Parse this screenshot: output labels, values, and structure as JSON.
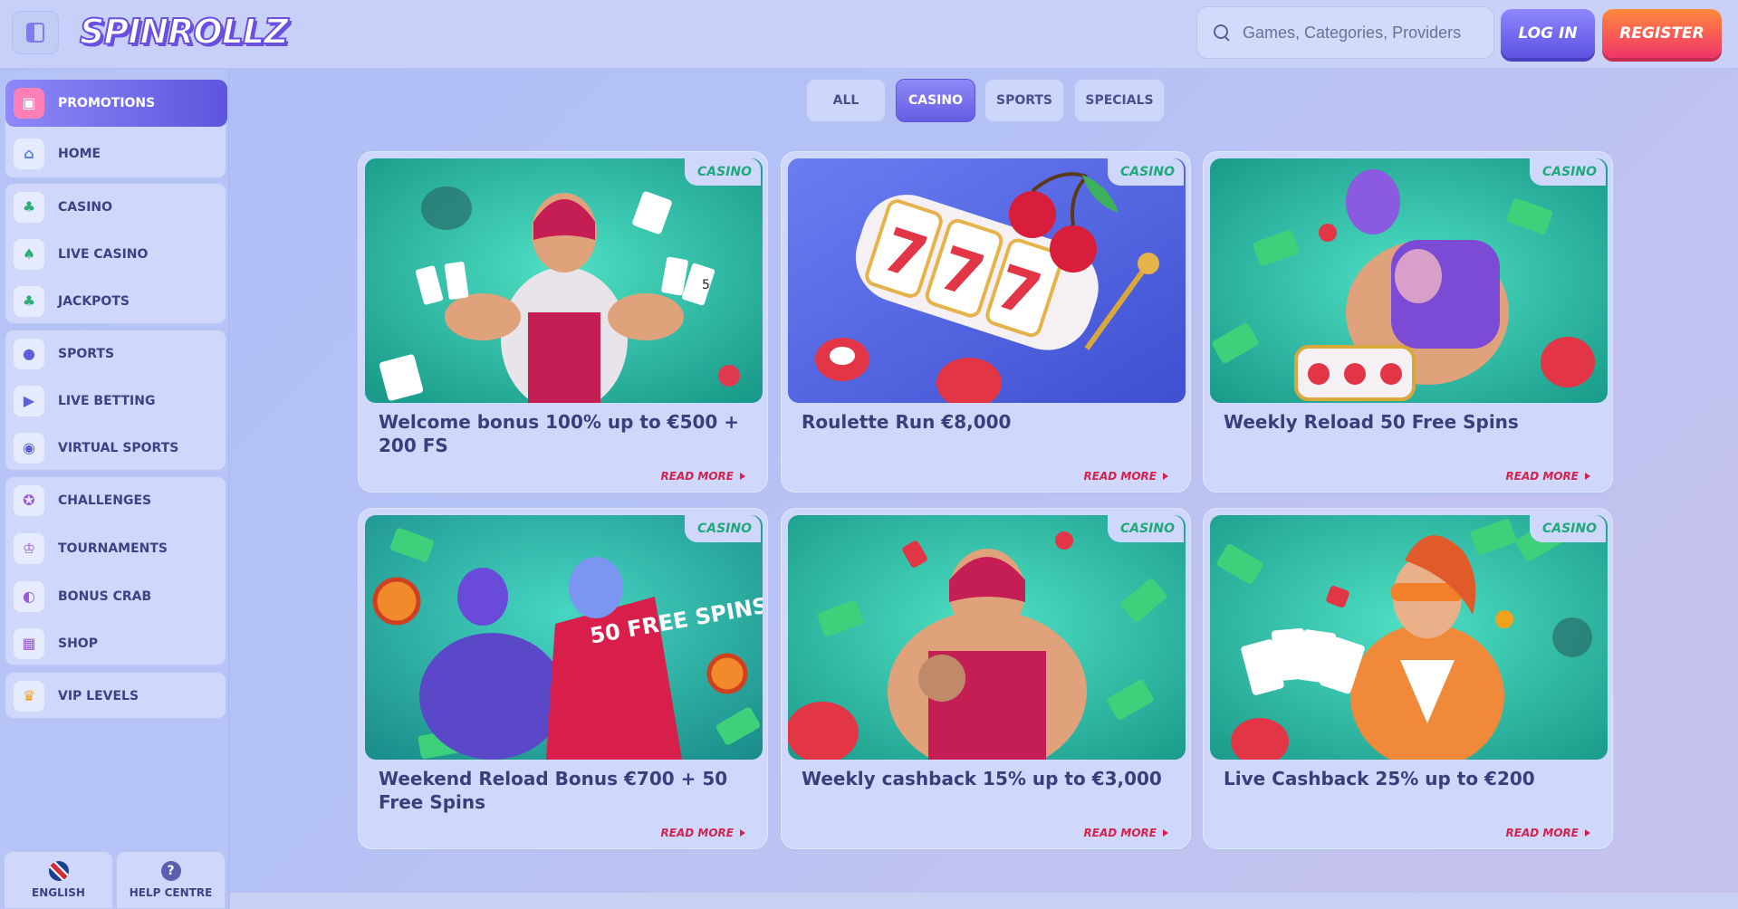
{
  "header": {
    "logo": "SPINROLLZ",
    "search_placeholder": "Games, Categories, Providers",
    "login_label": "LOG IN",
    "register_label": "REGISTER"
  },
  "sidebar": {
    "items": [
      {
        "label": "PROMOTIONS",
        "icon": "gift-icon",
        "glyph": "🎁"
      },
      {
        "label": "HOME",
        "icon": "home-icon",
        "glyph": "⌂"
      },
      {
        "label": "CASINO",
        "icon": "clover-icon",
        "glyph": "♣"
      },
      {
        "label": "LIVE CASINO",
        "icon": "cards-icon",
        "glyph": "♠"
      },
      {
        "label": "JACKPOTS",
        "icon": "shamrock-icon",
        "glyph": "☘"
      },
      {
        "label": "SPORTS",
        "icon": "ball-icon",
        "glyph": "⚽"
      },
      {
        "label": "LIVE BETTING",
        "icon": "play-icon",
        "glyph": "▶"
      },
      {
        "label": "VIRTUAL SPORTS",
        "icon": "gamepad-icon",
        "glyph": "◉"
      },
      {
        "label": "CHALLENGES",
        "icon": "medal-icon",
        "glyph": "✪"
      },
      {
        "label": "TOURNAMENTS",
        "icon": "trophy-icon",
        "glyph": "♔"
      },
      {
        "label": "BONUS CRAB",
        "icon": "crab-icon",
        "glyph": "◐"
      },
      {
        "label": "SHOP",
        "icon": "shop-icon",
        "glyph": "▦"
      },
      {
        "label": "VIP LEVELS",
        "icon": "crown-icon",
        "glyph": "♛"
      }
    ],
    "language_label": "ENGLISH",
    "help_label": "HELP CENTRE"
  },
  "tabs": [
    "ALL",
    "CASINO",
    "SPORTS",
    "SPECIALS"
  ],
  "active_tab": "CASINO",
  "promotions": [
    {
      "category": "CASINO",
      "title": "Welcome bonus 100% up to €500 + 200 FS",
      "cta": "READ MORE"
    },
    {
      "category": "CASINO",
      "title": "Roulette Run €8,000",
      "cta": "READ MORE"
    },
    {
      "category": "CASINO",
      "title": "Weekly Reload 50 Free Spins",
      "cta": "READ MORE"
    },
    {
      "category": "CASINO",
      "title": "Weekend Reload Bonus €700 + 50 Free Spins",
      "cta": "READ MORE"
    },
    {
      "category": "CASINO",
      "title": "Weekly cashback 15% up to €3,000",
      "cta": "READ MORE"
    },
    {
      "category": "CASINO",
      "title": "Live Cashback 25% up to €200",
      "cta": "READ MORE"
    }
  ],
  "image_texts": {
    "slot_reels": "777",
    "card_values": "5",
    "free_spins_shirt": "50 FREE SPINS"
  },
  "colors": {
    "accent_purple": "#5d55dd",
    "register_orange": "#ff8a3c",
    "register_pink": "#f0346a",
    "badge_green": "#1fa87a",
    "read_more_red": "#d1234e"
  }
}
